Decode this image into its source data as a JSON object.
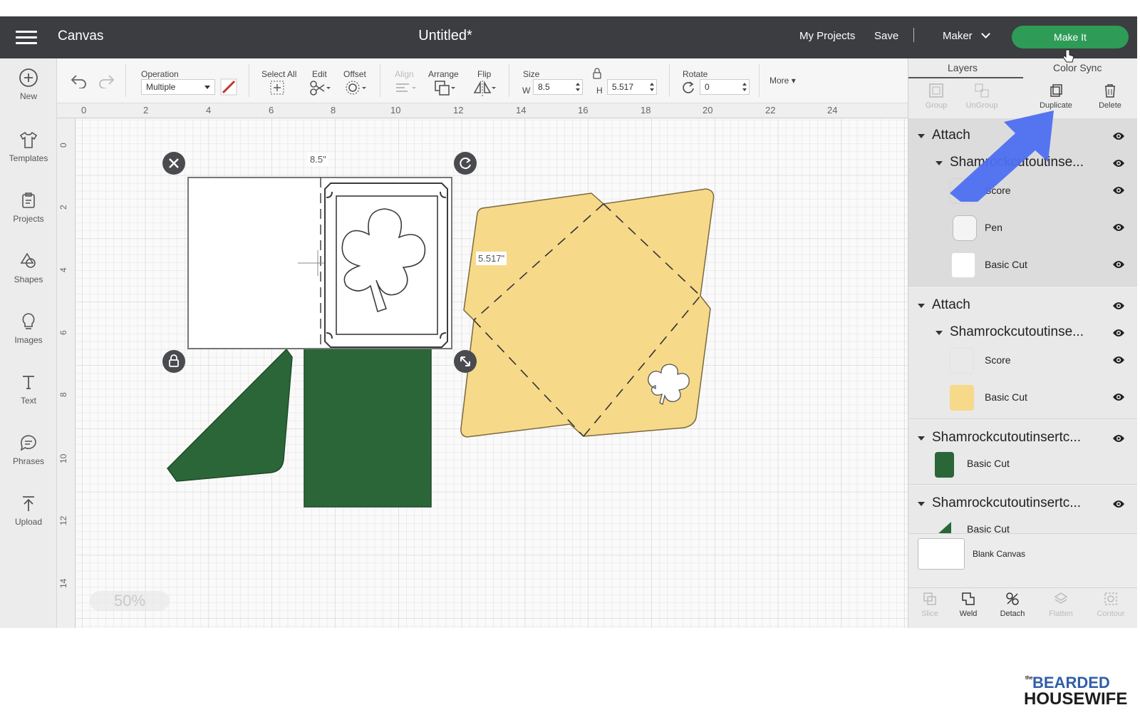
{
  "header": {
    "app_title": "Canvas",
    "doc_title": "Untitled*",
    "my_projects": "My Projects",
    "save": "Save",
    "separator": "|",
    "machine": "Maker",
    "make_it": "Make It"
  },
  "sidebar": {
    "items": [
      {
        "label": "New",
        "icon": "plus-circle-icon"
      },
      {
        "label": "Templates",
        "icon": "shirt-icon"
      },
      {
        "label": "Projects",
        "icon": "projects-icon"
      },
      {
        "label": "Shapes",
        "icon": "shapes-icon"
      },
      {
        "label": "Images",
        "icon": "lightbulb-icon"
      },
      {
        "label": "Text",
        "icon": "text-icon"
      },
      {
        "label": "Phrases",
        "icon": "speech-bubble-icon"
      },
      {
        "label": "Upload",
        "icon": "upload-icon"
      }
    ]
  },
  "toolbar": {
    "operation_label": "Operation",
    "operation_value": "Multiple",
    "select_all": "Select All",
    "edit": "Edit",
    "offset": "Offset",
    "align": "Align",
    "arrange": "Arrange",
    "flip": "Flip",
    "size_label": "Size",
    "w_label": "W",
    "w_value": "8.5",
    "h_label": "H",
    "h_value": "5.517",
    "rotate_label": "Rotate",
    "rotate_value": "0",
    "more": "More"
  },
  "canvas": {
    "ruler_top": [
      "0",
      "2",
      "4",
      "6",
      "8",
      "10",
      "12",
      "14",
      "16",
      "18",
      "20",
      "22",
      "24"
    ],
    "ruler_left": [
      "0",
      "2",
      "4",
      "6",
      "8",
      "10",
      "12",
      "14"
    ],
    "width_label": "8.5\"",
    "height_label": "5.517\"",
    "zoom": "50%",
    "colors": {
      "green": "#2b6638",
      "yellow": "#f7d98a",
      "card": "#ffffff"
    }
  },
  "layers_panel": {
    "tabs": [
      "Layers",
      "Color Sync"
    ],
    "actions": [
      {
        "label": "Group",
        "enabled": false
      },
      {
        "label": "UnGroup",
        "enabled": false
      },
      {
        "label": "Duplicate",
        "enabled": true
      },
      {
        "label": "Delete",
        "enabled": true
      }
    ],
    "groups": [
      {
        "name": "Attach",
        "sub": "Shamrockcutoutinse...",
        "layers": [
          "Score",
          "Pen",
          "Basic Cut"
        ]
      },
      {
        "name": "Attach",
        "sub": "Shamrockcutoutinse...",
        "layers": [
          "Score",
          "Basic Cut"
        ]
      },
      {
        "name": "Shamrockcutoutinsertc...",
        "layers": [
          "Basic Cut"
        ]
      },
      {
        "name": "Shamrockcutoutinsertc...",
        "layers": [
          "Basic Cut"
        ]
      }
    ],
    "blank_canvas": "Blank Canvas",
    "bottom_tools": [
      {
        "label": "Slice",
        "enabled": false
      },
      {
        "label": "Weld",
        "enabled": true
      },
      {
        "label": "Detach",
        "enabled": true
      },
      {
        "label": "Flatten",
        "enabled": false
      },
      {
        "label": "Contour",
        "enabled": false
      }
    ]
  },
  "logo": {
    "the": "the",
    "line1": "BEARDED",
    "line2": "HOUSEWIFE"
  }
}
